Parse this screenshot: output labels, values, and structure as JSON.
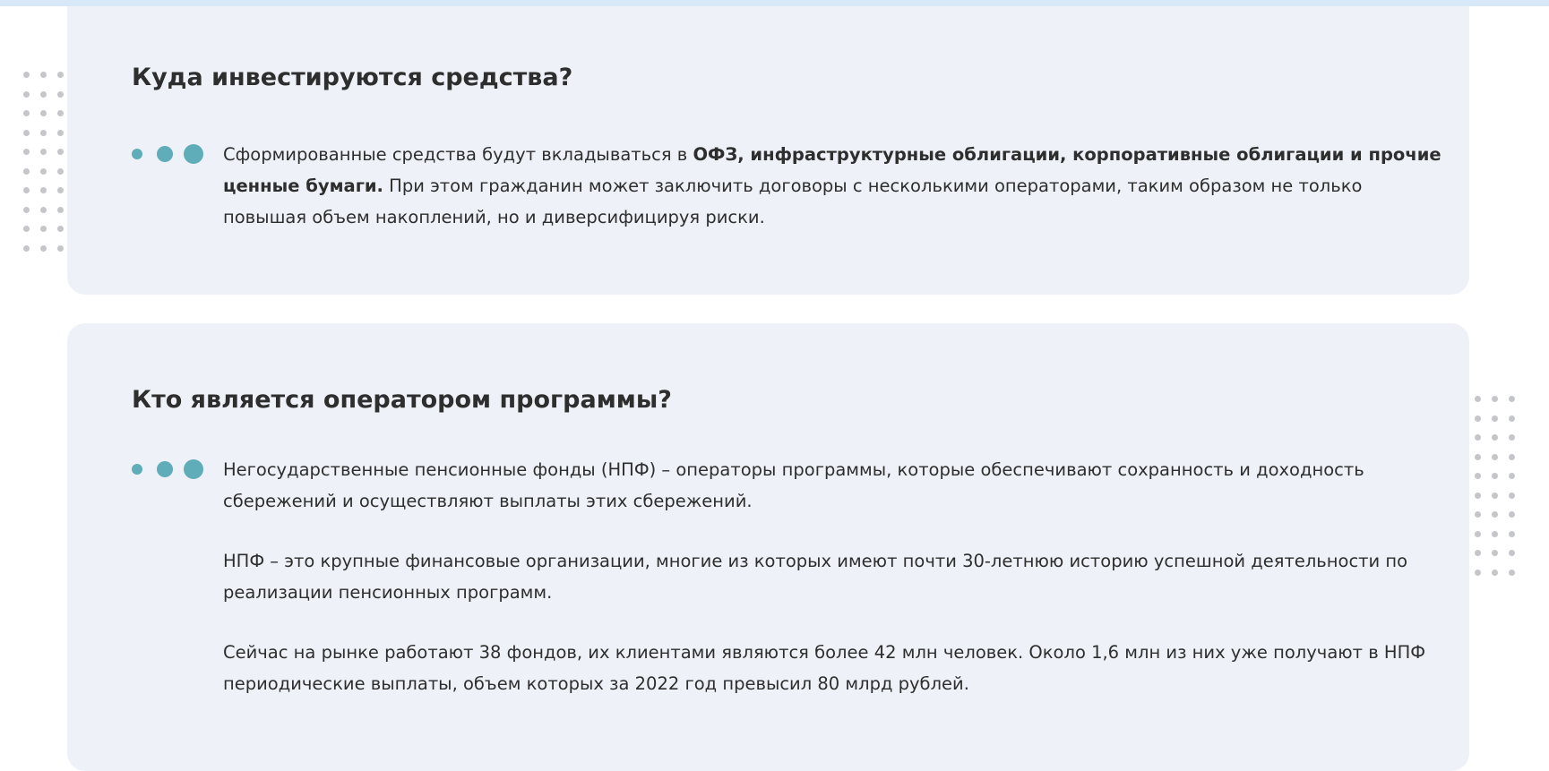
{
  "colors": {
    "card_bg": "#eef2f8",
    "accent": "#5eadb8",
    "text": "#2e2e2e",
    "top_strip": "#d7e9f8",
    "decor_dots": "#c4c6ca"
  },
  "sections": [
    {
      "title": "Куда инвестируются средства?",
      "bullet_icon": "three-dots-bullet-icon",
      "paragraphs": [
        {
          "before": "Сформированные средства будут вкладываться в ",
          "bold": "ОФЗ, инфраструктурные облигации, корпоративные облигации и прочие ценные бумаги.",
          "after": " При этом гражданин может заключить договоры с несколькими операторами, таким образом не только повышая объем накоплений, но и диверсифицируя риски."
        }
      ]
    },
    {
      "title": "Кто является оператором программы?",
      "bullet_icon": "three-dots-bullet-icon",
      "paragraphs": [
        "Негосударственные пенсионные фонды (НПФ) – операторы программы, которые обеспечивают сохранность и доходность сбережений и осуществляют выплаты этих сбережений.",
        "НПФ – это крупные финансовые организации, многие из которых имеют почти 30-летнюю историю успешной деятельности по реализации пенсионных программ.",
        "Сейчас на рынке работают 38 фондов, их клиентами являются более 42 млн человек. Около 1,6 млн из них уже получают в НПФ периодические выплаты, объем которых за 2022 год превысил 80 млрд рублей."
      ]
    }
  ]
}
